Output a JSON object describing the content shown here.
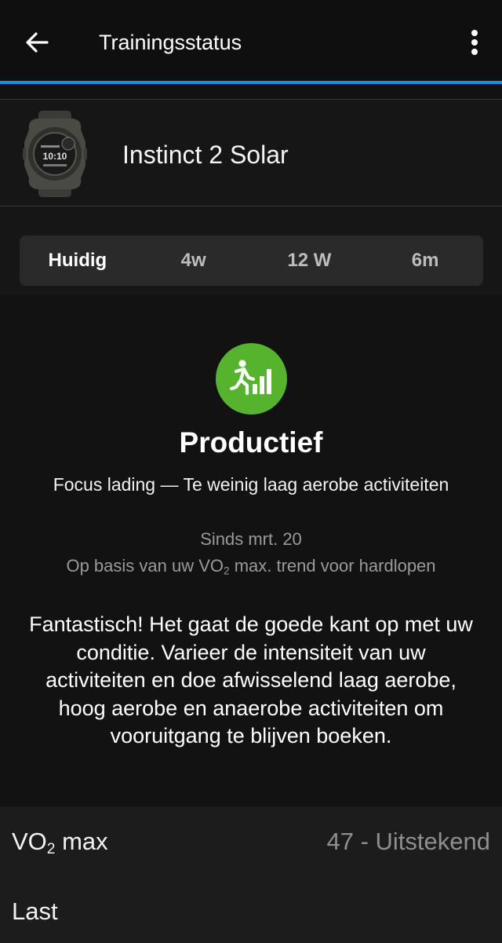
{
  "appbar": {
    "title": "Trainingsstatus"
  },
  "device": {
    "name": "Instinct 2 Solar",
    "watch_time": "10:10"
  },
  "tabs": [
    {
      "label": "Huidig",
      "active": true
    },
    {
      "label": "4w",
      "active": false
    },
    {
      "label": "12 W",
      "active": false
    },
    {
      "label": "6m",
      "active": false
    }
  ],
  "status": {
    "title": "Productief",
    "icon_color": "#55b32e",
    "focus_text": "Focus lading — Te weinig laag aerobe activiteiten",
    "since_text": "Sinds mrt. 20",
    "basis_prefix": "Op basis van uw VO",
    "basis_sub": "2",
    "basis_suffix": " max. trend voor hardlopen",
    "message": "Fantastisch! Het gaat de goede kant op met uw conditie. Varieer de intensiteit van uw activiteiten en doe afwisselend laag aerobe, hoog aerobe en anaerobe activiteiten om vooruitgang te blijven boeken."
  },
  "metrics": {
    "vo2": {
      "label_prefix": "VO",
      "label_sub": "2",
      "label_suffix": " max",
      "value": "47 - Uitstekend"
    },
    "load": {
      "label": "Last"
    }
  },
  "colors": {
    "accent": "#1f8fe0",
    "status_green": "#55b32e",
    "background": "#121212"
  }
}
